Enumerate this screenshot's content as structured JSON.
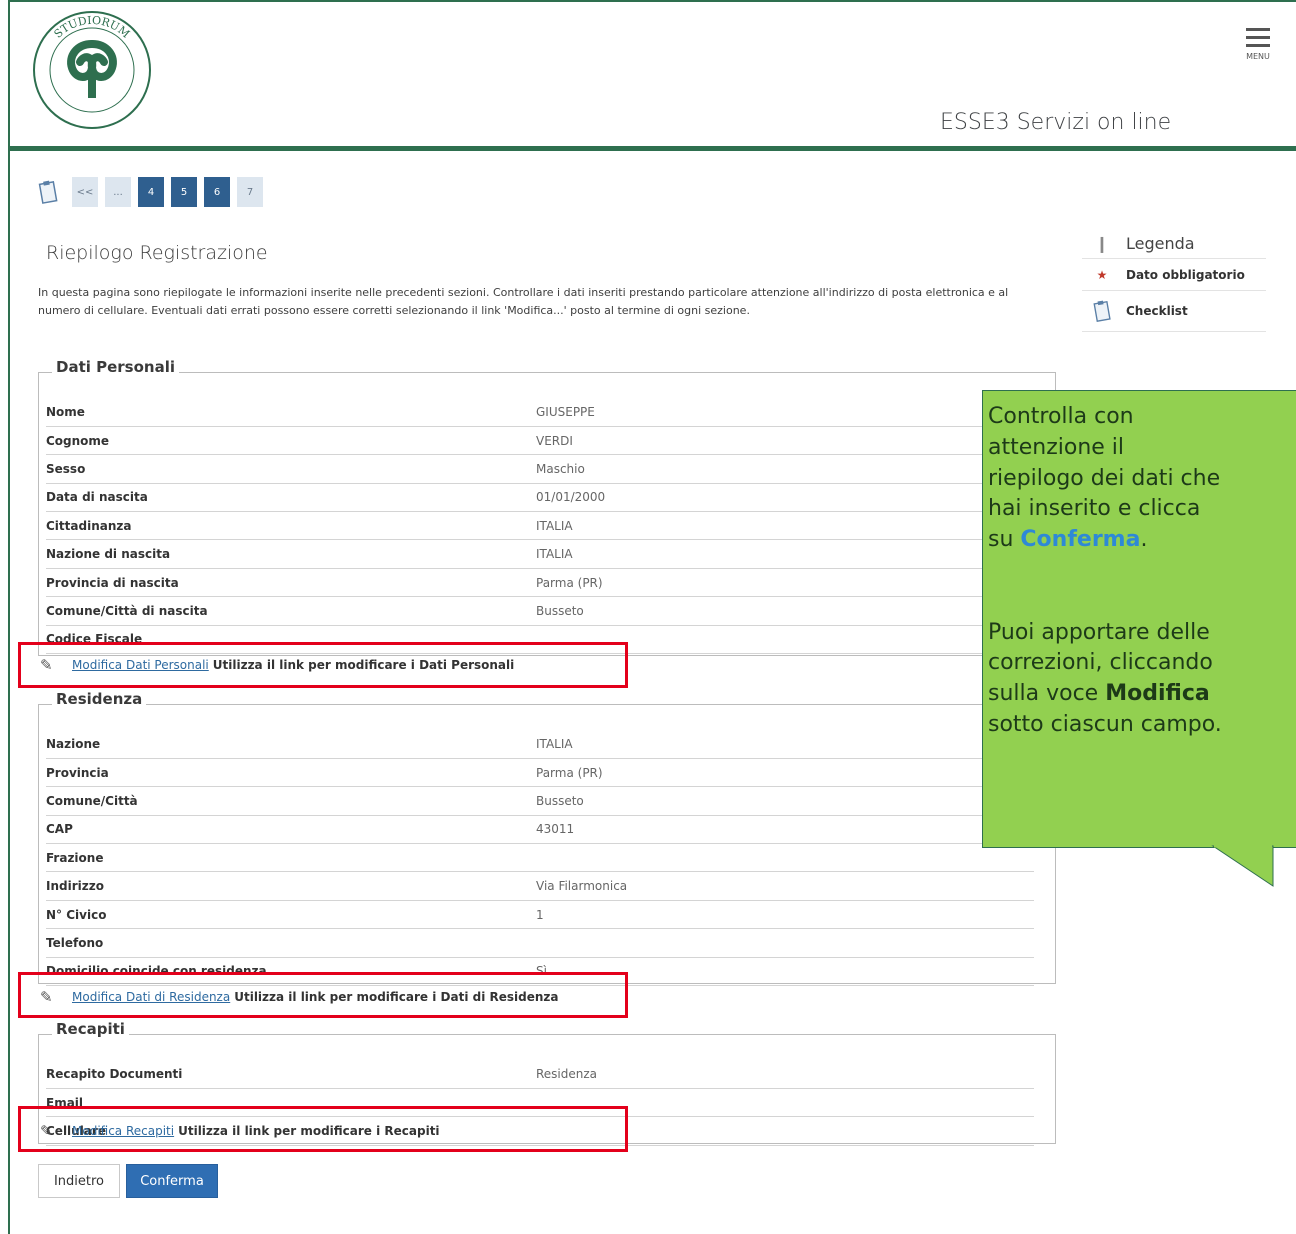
{
  "header": {
    "logo_text_top": "STUDIORUM",
    "logo_text_left": "UNIVERSITAS",
    "logo_text_right": "INSUBRIAE",
    "menu_label": "MENU",
    "portal_title": "ESSE3 Servizi on line"
  },
  "pager": {
    "first_label": "<<",
    "ellipsis": "...",
    "pages": [
      "4",
      "5",
      "6",
      "7"
    ],
    "active_page": "6"
  },
  "page": {
    "title": "Riepilogo Registrazione",
    "intro": "In questa pagina sono riepilogate le informazioni inserite nelle precedenti sezioni. Controllare i dati inseriti prestando particolare attenzione all'indirizzo di posta elettronica e al numero di cellulare. Eventuali dati errati possono essere corretti selezionando il link 'Modifica...' posto al termine di ogni sezione."
  },
  "legend": {
    "title": "Legenda",
    "required": "Dato obbligatorio",
    "checklist": "Checklist"
  },
  "personal": {
    "title": "Dati Personali",
    "rows": [
      {
        "k": "Nome",
        "v": "GIUSEPPE"
      },
      {
        "k": "Cognome",
        "v": "VERDI"
      },
      {
        "k": "Sesso",
        "v": "Maschio"
      },
      {
        "k": "Data di nascita",
        "v": "01/01/2000"
      },
      {
        "k": "Cittadinanza",
        "v": "ITALIA"
      },
      {
        "k": "Nazione di nascita",
        "v": "ITALIA"
      },
      {
        "k": "Provincia di nascita",
        "v": "Parma (PR)"
      },
      {
        "k": "Comune/Città di nascita",
        "v": "Busseto"
      },
      {
        "k": "Codice Fiscale",
        "v": ""
      }
    ],
    "edit_link": "Modifica Dati Personali",
    "edit_hint": "Utilizza il link per modificare i Dati Personali"
  },
  "residence": {
    "title": "Residenza",
    "rows": [
      {
        "k": "Nazione",
        "v": "ITALIA"
      },
      {
        "k": "Provincia",
        "v": "Parma (PR)"
      },
      {
        "k": "Comune/Città",
        "v": "Busseto"
      },
      {
        "k": "CAP",
        "v": "43011"
      },
      {
        "k": "Frazione",
        "v": ""
      },
      {
        "k": "Indirizzo",
        "v": "Via Filarmonica"
      },
      {
        "k": "N° Civico",
        "v": "1"
      },
      {
        "k": "Telefono",
        "v": ""
      },
      {
        "k": "Domicilio coincide con residenza",
        "v": "Sì"
      }
    ],
    "edit_link": "Modifica Dati di Residenza",
    "edit_hint": "Utilizza il link per modificare i Dati di Residenza"
  },
  "contacts": {
    "title": "Recapiti",
    "rows": [
      {
        "k": "Recapito Documenti",
        "v": "Residenza"
      },
      {
        "k": "Email",
        "v": ""
      },
      {
        "k": "Cellulare",
        "v": ""
      }
    ],
    "edit_link": "Modifica Recapiti",
    "edit_hint": "Utilizza il link per modificare i Recapiti"
  },
  "buttons": {
    "back": "Indietro",
    "confirm": "Conferma"
  },
  "callout": {
    "line1": "Controlla con",
    "line2": "attenzione il",
    "line3": "riepilogo dei dati che",
    "line4": "hai inserito e clicca",
    "line5_pre": "su ",
    "line5_accent": "Conferma",
    "line5_post": ".",
    "line6": "Puoi apportare delle",
    "line7": "correzioni, cliccando",
    "line8_pre": "sulla voce ",
    "line8_bold": "Modifica",
    "line9": "sotto ciascun campo."
  },
  "colors": {
    "brand_green": "#2e6f4f",
    "callout_green": "#92d050",
    "accent_blue": "#2e89d6",
    "highlight_red": "#e3001b",
    "button_blue": "#2f6eb3"
  }
}
